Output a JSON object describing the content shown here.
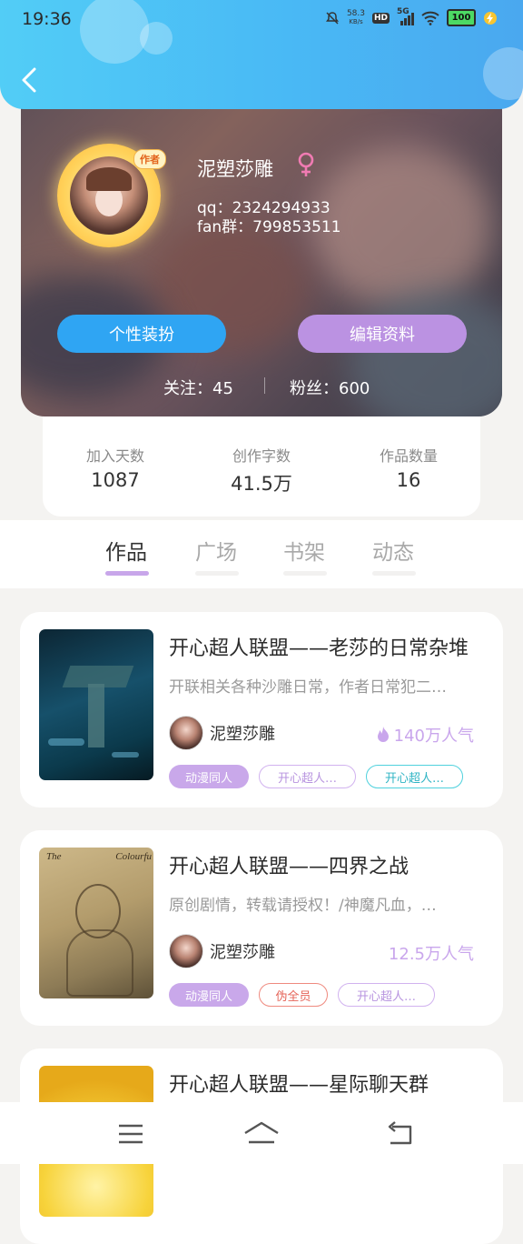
{
  "status_bar": {
    "time": "19:36",
    "net_speed_value": "58.3",
    "net_speed_unit": "KB/s",
    "hd_badge": "HD",
    "network_type": "5G",
    "battery": "100",
    "icons": [
      "mute-icon",
      "hd-icon",
      "signal-icon",
      "wifi-icon",
      "battery-icon",
      "charging-icon"
    ]
  },
  "header": {
    "back_icon": "chevron-left-icon",
    "accent": "#49b9f5"
  },
  "profile": {
    "avatar_badge": "作者",
    "name": "泥塑莎雕",
    "gender_icon": "female-icon",
    "gender_color": "#f07bb2",
    "qq": "qq：2324294933",
    "fan_group": "fan群：799853511",
    "dress_button": "个性装扮",
    "edit_button": "编辑资料",
    "following": "关注：45",
    "followers": "粉丝：600"
  },
  "stats": [
    {
      "label": "加入天数",
      "value": "1087"
    },
    {
      "label": "创作字数",
      "value": "41.5万"
    },
    {
      "label": "作品数量",
      "value": "16"
    }
  ],
  "tabs": [
    {
      "label": "作品",
      "active": true
    },
    {
      "label": "广场",
      "active": false
    },
    {
      "label": "书架",
      "active": false
    },
    {
      "label": "动态",
      "active": false
    }
  ],
  "works": [
    {
      "title": "开心超人联盟——老莎的日常杂堆",
      "description": "开联相关各种沙雕日常，作者日常犯二…",
      "author": "泥塑莎雕",
      "popularity": "140万人气",
      "popularity_icon": "flame-icon",
      "tags": [
        {
          "label": "动漫同人",
          "style": "filled"
        },
        {
          "label": "开心超人…",
          "style": "purple"
        },
        {
          "label": "开心超人…",
          "style": "cyan"
        }
      ]
    },
    {
      "title": "开心超人联盟——四界之战",
      "description": "原创剧情，转载请授权！/神魔凡血，…",
      "author": "泥塑莎雕",
      "popularity": "12.5万人气",
      "tags": [
        {
          "label": "动漫同人",
          "style": "filled"
        },
        {
          "label": "伪全员",
          "style": "red"
        },
        {
          "label": "开心超人…",
          "style": "purple"
        }
      ]
    },
    {
      "title": "开心超人联盟——星际聊天群"
    }
  ],
  "cover_text": {
    "work2_left": "The",
    "work2_right": "Colourfu"
  },
  "nav_bar": {
    "icons": [
      "menu-icon",
      "home-icon",
      "back-nav-icon"
    ]
  }
}
